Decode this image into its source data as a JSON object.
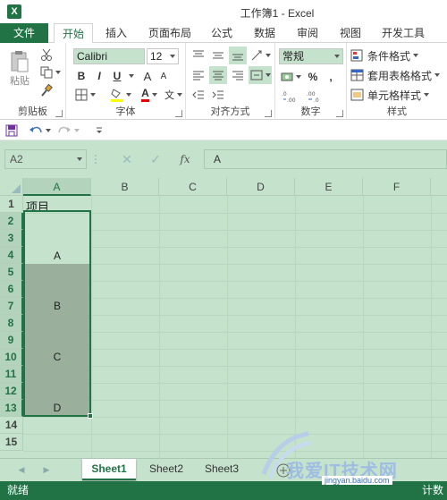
{
  "window": {
    "title": "工作簿1 - Excel",
    "logo": "X"
  },
  "tabs": [
    {
      "label": "文件"
    },
    {
      "label": "开始"
    },
    {
      "label": "插入"
    },
    {
      "label": "页面布局"
    },
    {
      "label": "公式"
    },
    {
      "label": "数据"
    },
    {
      "label": "审阅"
    },
    {
      "label": "视图"
    },
    {
      "label": "开发工具"
    }
  ],
  "ribbon": {
    "clipboard": {
      "label": "剪贴板",
      "paste": "粘贴"
    },
    "font": {
      "label": "字体",
      "name": "Calibri",
      "size": "12",
      "bold": "B",
      "italic": "I",
      "underline": "U",
      "grow": "A",
      "shrink": "A",
      "color_letter": "A",
      "wen": "文"
    },
    "alignment": {
      "label": "对齐方式"
    },
    "number": {
      "label": "数字",
      "format": "常规",
      "percent": "%",
      "comma": ","
    },
    "styles": {
      "label": "样式",
      "conditional": "条件格式",
      "table": "套用表格格式",
      "cell": "单元格样式"
    }
  },
  "formula_bar": {
    "name_box": "A2",
    "fx": "fx",
    "value": "A"
  },
  "columns": [
    "A",
    "B",
    "C",
    "D",
    "E",
    "F"
  ],
  "rows": [
    "1",
    "2",
    "3",
    "4",
    "5",
    "6",
    "7",
    "8",
    "9",
    "10",
    "11",
    "12",
    "13",
    "14",
    "15"
  ],
  "cells": {
    "a1": "项目",
    "a2_4": "A",
    "a5_7": "B",
    "a8_10": "C",
    "a11_13": "D"
  },
  "sheets": [
    "Sheet1",
    "Sheet2",
    "Sheet3"
  ],
  "status": {
    "ready": "就绪",
    "right": "计数"
  },
  "watermark": {
    "text": "我爱IT技术网",
    "url": "jingyan.baidu.com"
  },
  "colors": {
    "accent": "#217346",
    "grid_bg": "#c4e2cc",
    "merged": "#9aaf9c"
  }
}
